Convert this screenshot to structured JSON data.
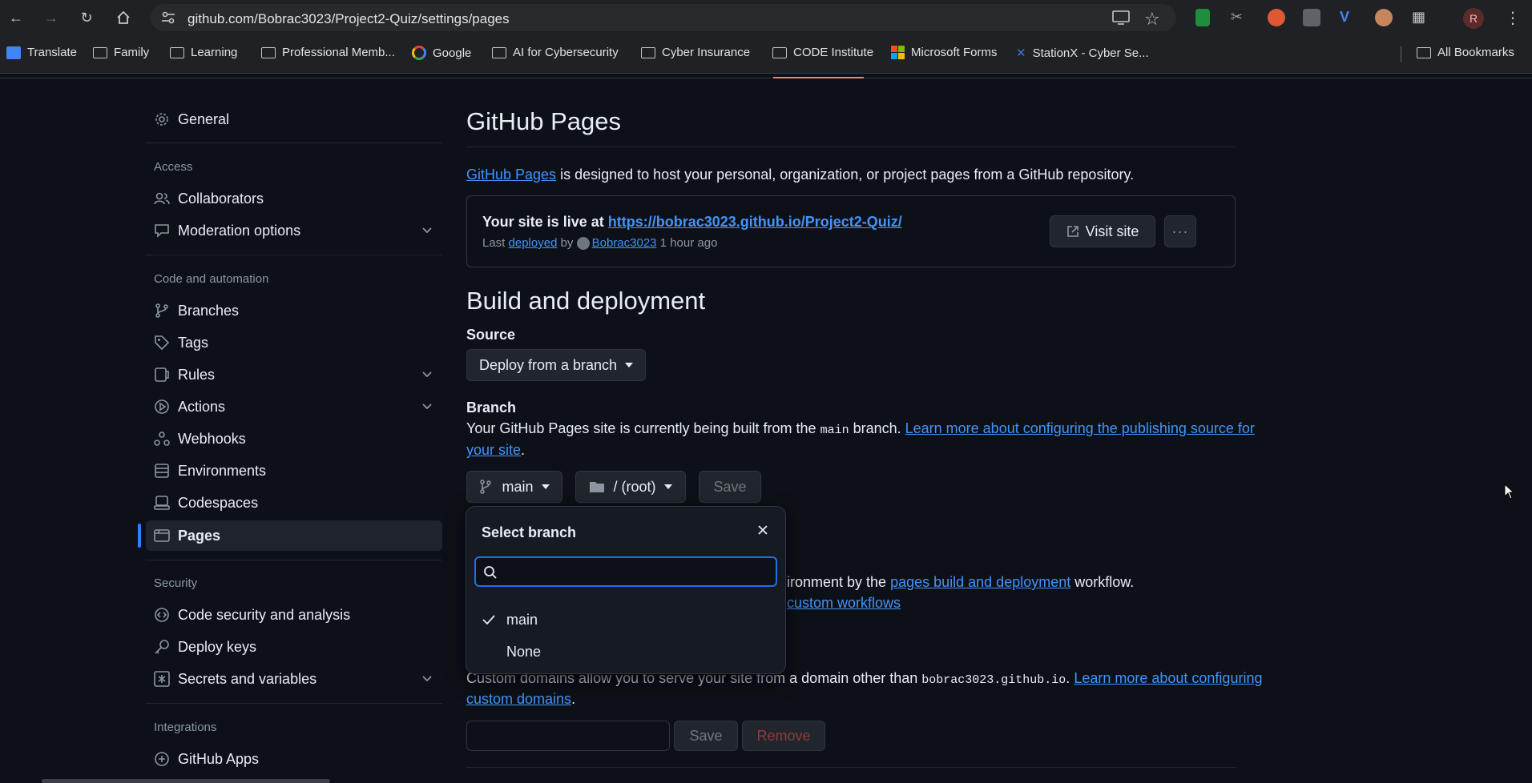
{
  "browser": {
    "url": "github.com/Bobrac3023/Project2-Quiz/settings/pages",
    "profile_initial": "R",
    "bookmarks": [
      "Translate",
      "Family",
      "Learning",
      "Professional Memb...",
      "Google",
      "AI for Cybersecurity",
      "Cyber Insurance",
      "CODE Institute",
      "Microsoft Forms",
      "StationX - Cyber Se..."
    ],
    "all_bookmarks": "All Bookmarks"
  },
  "sidebar": {
    "general": "General",
    "access_heading": "Access",
    "collaborators": "Collaborators",
    "moderation": "Moderation options",
    "code_heading": "Code and automation",
    "branches": "Branches",
    "tags": "Tags",
    "rules": "Rules",
    "actions": "Actions",
    "webhooks": "Webhooks",
    "environments": "Environments",
    "codespaces": "Codespaces",
    "pages": "Pages",
    "security_heading": "Security",
    "code_security": "Code security and analysis",
    "deploy_keys": "Deploy keys",
    "secrets": "Secrets and variables",
    "integrations_heading": "Integrations",
    "github_apps": "GitHub Apps"
  },
  "main": {
    "title": "GitHub Pages",
    "intro_link": "GitHub Pages",
    "intro_text": " is designed to host your personal, organization, or project pages from a GitHub repository.",
    "live_prefix": "Your site is live at ",
    "live_url": "https://bobrac3023.github.io/Project2-Quiz/",
    "last": "Last ",
    "deployed": "deployed",
    "by": " by ",
    "user": "Bobrac3023",
    "ago": " 1 hour ago",
    "visit_site": "Visit site",
    "build_title": "Build and deployment",
    "source_label": "Source",
    "source_value": "Deploy from a branch",
    "branch_label": "Branch",
    "branch_text_1": "Your GitHub Pages site is currently being built from the ",
    "branch_code": "main",
    "branch_text_2": " branch. ",
    "branch_link_1": "Learn more about configuring the publishing source for",
    "branch_link_2": "your site",
    "branch_period": ".",
    "branch_btn": "main",
    "folder_btn": "/ (root)",
    "save": "Save",
    "workflow_text_1": "ironment by the ",
    "workflow_link": "pages build and deployment",
    "workflow_text_2": " workflow.",
    "custom_workflows": "custom workflows",
    "custom_text_1": "Custom domains allow you to serve your site from a domain other than ",
    "custom_code": "bobrac3023.github.io",
    "custom_text_2": ". ",
    "custom_link_1": "Learn more about configuring",
    "custom_link_2": "custom domains",
    "custom_period": ".",
    "custom_save": "Save",
    "remove": "Remove"
  },
  "popover": {
    "title": "Select branch",
    "search_placeholder": "",
    "options": [
      "main",
      "None"
    ],
    "selected": "main"
  }
}
